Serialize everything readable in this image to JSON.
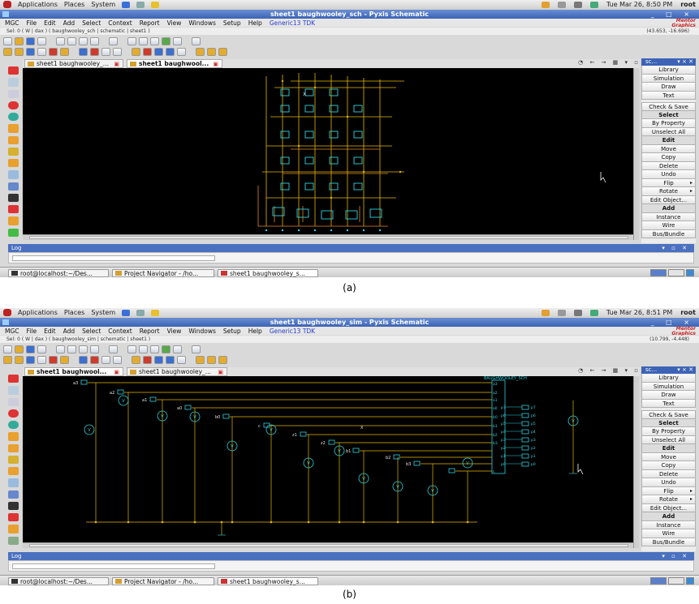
{
  "screens": [
    {
      "id": "a",
      "caption": "(a)",
      "top_panel": {
        "menus": [
          "Applications",
          "Places",
          "System"
        ],
        "clock": "Tue Mar 26,  8:50 PM",
        "user": "root"
      },
      "window_title": "sheet1 baughwooley_sch  - Pyxis Schematic",
      "menubar": [
        "MGC",
        "File",
        "Edit",
        "Add",
        "Select",
        "Context",
        "Report",
        "View",
        "Windows",
        "Setup",
        "Help",
        "Generic13 TDK"
      ],
      "brand": "Mentor Graphics",
      "selection_bar": {
        "text": "Sel:  0      ( W | dax )  ( baughwooley_sch | schematic | sheet1 )",
        "coords": "(43.653, -16.696)"
      },
      "tabs": [
        {
          "label": "sheet1 baughwooley_...",
          "active": false
        },
        {
          "label": "sheet1 baughwool...",
          "active": true
        }
      ],
      "right_panel": {
        "header": "sc...",
        "buttons": [
          "Library",
          "Simulation",
          "Draw",
          "Text",
          "Check & Save",
          "Select",
          "By Property",
          "Unselect All",
          "Edit",
          "Move",
          "Copy",
          "Delete",
          "Undo",
          "Flip",
          "Rotate",
          "Edit Object...",
          "Add",
          "Instance",
          "Wire",
          "Bus/Bundle"
        ]
      },
      "log_label": "Log",
      "taskbar": [
        "root@localhost:~/Des...",
        "Project Navigator - /ho...",
        "sheet1 baughwooley_s..."
      ]
    },
    {
      "id": "b",
      "caption": "(b)",
      "top_panel": {
        "menus": [
          "Applications",
          "Places",
          "System"
        ],
        "clock": "Tue Mar 26,  8:51 PM",
        "user": "root"
      },
      "window_title": "sheet1 baughwooley_sim  - Pyxis Schematic",
      "menubar": [
        "MGC",
        "File",
        "Edit",
        "Add",
        "Select",
        "Context",
        "Report",
        "View",
        "Windows",
        "Setup",
        "Help",
        "Generic13 TDK"
      ],
      "brand": "Mentor Graphics",
      "selection_bar": {
        "text": "Sel:  0      ( W | dax )  ( baughwooley_sim | schematic | sheet1 )",
        "coords": "(10.799, -4.448)"
      },
      "tabs": [
        {
          "label": "sheet1 baughwool...",
          "active": true
        },
        {
          "label": "sheet1 baughwooley_...",
          "active": false
        }
      ],
      "right_panel": {
        "header": "sc...",
        "buttons": [
          "Library",
          "Simulation",
          "Draw",
          "Text",
          "Check & Save",
          "Select",
          "By Property",
          "Unselect All",
          "Edit",
          "Move",
          "Copy",
          "Delete",
          "Undo",
          "Flip",
          "Rotate",
          "Edit Object...",
          "Add",
          "Instance",
          "Wire",
          "Bus/Bundle"
        ]
      },
      "log_label": "Log",
      "taskbar": [
        "root@localhost:~/Des...",
        "Project Navigator - /ho...",
        "sheet1 baughwooley_s..."
      ],
      "schematic": {
        "block_name": "BAUGHWOOLEY_SCH",
        "inputs": [
          "a3",
          "a2",
          "a1",
          "a0",
          "b0",
          "c",
          "z1",
          "z2",
          "b1",
          "b2",
          "b3"
        ],
        "input_pins": [
          "a3",
          "a2",
          "a1",
          "a0",
          "b0",
          "b1",
          "b2",
          "b3",
          "c"
        ],
        "outputs": [
          "p7",
          "p6",
          "p5",
          "p4",
          "p3",
          "p2",
          "p1",
          "p0"
        ]
      }
    }
  ],
  "colors": {
    "canvas": "#000000",
    "wire_yellow": "#e6b800",
    "wire_orange": "#e08a2a",
    "component_cyan": "#2fd3e0",
    "title_blue": "#3c63b5"
  }
}
